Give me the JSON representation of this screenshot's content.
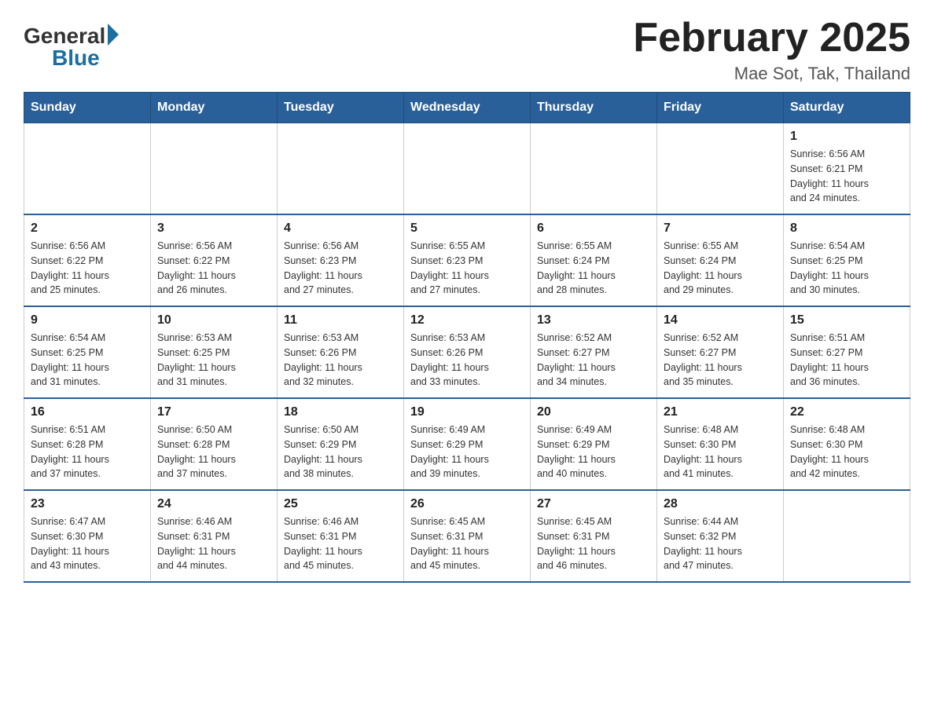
{
  "logo": {
    "general": "General",
    "blue": "Blue"
  },
  "title": "February 2025",
  "subtitle": "Mae Sot, Tak, Thailand",
  "days_of_week": [
    "Sunday",
    "Monday",
    "Tuesday",
    "Wednesday",
    "Thursday",
    "Friday",
    "Saturday"
  ],
  "weeks": [
    [
      {
        "day": "",
        "info": ""
      },
      {
        "day": "",
        "info": ""
      },
      {
        "day": "",
        "info": ""
      },
      {
        "day": "",
        "info": ""
      },
      {
        "day": "",
        "info": ""
      },
      {
        "day": "",
        "info": ""
      },
      {
        "day": "1",
        "info": "Sunrise: 6:56 AM\nSunset: 6:21 PM\nDaylight: 11 hours\nand 24 minutes."
      }
    ],
    [
      {
        "day": "2",
        "info": "Sunrise: 6:56 AM\nSunset: 6:22 PM\nDaylight: 11 hours\nand 25 minutes."
      },
      {
        "day": "3",
        "info": "Sunrise: 6:56 AM\nSunset: 6:22 PM\nDaylight: 11 hours\nand 26 minutes."
      },
      {
        "day": "4",
        "info": "Sunrise: 6:56 AM\nSunset: 6:23 PM\nDaylight: 11 hours\nand 27 minutes."
      },
      {
        "day": "5",
        "info": "Sunrise: 6:55 AM\nSunset: 6:23 PM\nDaylight: 11 hours\nand 27 minutes."
      },
      {
        "day": "6",
        "info": "Sunrise: 6:55 AM\nSunset: 6:24 PM\nDaylight: 11 hours\nand 28 minutes."
      },
      {
        "day": "7",
        "info": "Sunrise: 6:55 AM\nSunset: 6:24 PM\nDaylight: 11 hours\nand 29 minutes."
      },
      {
        "day": "8",
        "info": "Sunrise: 6:54 AM\nSunset: 6:25 PM\nDaylight: 11 hours\nand 30 minutes."
      }
    ],
    [
      {
        "day": "9",
        "info": "Sunrise: 6:54 AM\nSunset: 6:25 PM\nDaylight: 11 hours\nand 31 minutes."
      },
      {
        "day": "10",
        "info": "Sunrise: 6:53 AM\nSunset: 6:25 PM\nDaylight: 11 hours\nand 31 minutes."
      },
      {
        "day": "11",
        "info": "Sunrise: 6:53 AM\nSunset: 6:26 PM\nDaylight: 11 hours\nand 32 minutes."
      },
      {
        "day": "12",
        "info": "Sunrise: 6:53 AM\nSunset: 6:26 PM\nDaylight: 11 hours\nand 33 minutes."
      },
      {
        "day": "13",
        "info": "Sunrise: 6:52 AM\nSunset: 6:27 PM\nDaylight: 11 hours\nand 34 minutes."
      },
      {
        "day": "14",
        "info": "Sunrise: 6:52 AM\nSunset: 6:27 PM\nDaylight: 11 hours\nand 35 minutes."
      },
      {
        "day": "15",
        "info": "Sunrise: 6:51 AM\nSunset: 6:27 PM\nDaylight: 11 hours\nand 36 minutes."
      }
    ],
    [
      {
        "day": "16",
        "info": "Sunrise: 6:51 AM\nSunset: 6:28 PM\nDaylight: 11 hours\nand 37 minutes."
      },
      {
        "day": "17",
        "info": "Sunrise: 6:50 AM\nSunset: 6:28 PM\nDaylight: 11 hours\nand 37 minutes."
      },
      {
        "day": "18",
        "info": "Sunrise: 6:50 AM\nSunset: 6:29 PM\nDaylight: 11 hours\nand 38 minutes."
      },
      {
        "day": "19",
        "info": "Sunrise: 6:49 AM\nSunset: 6:29 PM\nDaylight: 11 hours\nand 39 minutes."
      },
      {
        "day": "20",
        "info": "Sunrise: 6:49 AM\nSunset: 6:29 PM\nDaylight: 11 hours\nand 40 minutes."
      },
      {
        "day": "21",
        "info": "Sunrise: 6:48 AM\nSunset: 6:30 PM\nDaylight: 11 hours\nand 41 minutes."
      },
      {
        "day": "22",
        "info": "Sunrise: 6:48 AM\nSunset: 6:30 PM\nDaylight: 11 hours\nand 42 minutes."
      }
    ],
    [
      {
        "day": "23",
        "info": "Sunrise: 6:47 AM\nSunset: 6:30 PM\nDaylight: 11 hours\nand 43 minutes."
      },
      {
        "day": "24",
        "info": "Sunrise: 6:46 AM\nSunset: 6:31 PM\nDaylight: 11 hours\nand 44 minutes."
      },
      {
        "day": "25",
        "info": "Sunrise: 6:46 AM\nSunset: 6:31 PM\nDaylight: 11 hours\nand 45 minutes."
      },
      {
        "day": "26",
        "info": "Sunrise: 6:45 AM\nSunset: 6:31 PM\nDaylight: 11 hours\nand 45 minutes."
      },
      {
        "day": "27",
        "info": "Sunrise: 6:45 AM\nSunset: 6:31 PM\nDaylight: 11 hours\nand 46 minutes."
      },
      {
        "day": "28",
        "info": "Sunrise: 6:44 AM\nSunset: 6:32 PM\nDaylight: 11 hours\nand 47 minutes."
      },
      {
        "day": "",
        "info": ""
      }
    ]
  ]
}
